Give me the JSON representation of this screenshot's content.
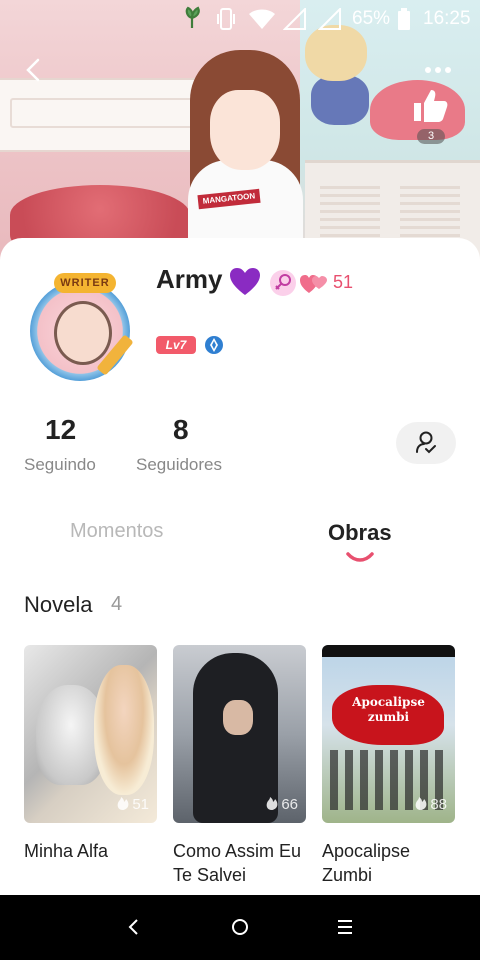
{
  "status_bar": {
    "battery": "65%",
    "time": "16:25"
  },
  "header": {
    "like_count": "3"
  },
  "profile": {
    "username": "Army",
    "avatar_badge": "WRITER",
    "hearts_count": "51",
    "level": "Lv7"
  },
  "stats": [
    {
      "value": "12",
      "label": "Seguindo"
    },
    {
      "value": "8",
      "label": "Seguidores"
    }
  ],
  "tabs": [
    {
      "label": "Momentos",
      "active": false
    },
    {
      "label": "Obras",
      "active": true
    }
  ],
  "section": {
    "title": "Novela",
    "count": "4"
  },
  "books": [
    {
      "title": "Minha Alfa",
      "views": "51"
    },
    {
      "title": "Como Assim Eu Te Salvei",
      "views": "66"
    },
    {
      "title": "Apocalipse Zumbi",
      "views": "88",
      "cover_text": "Apocalipse zumbi"
    }
  ],
  "banner_shirt_text": "MANGATOON",
  "colors": {
    "accent_pink": "#e8506f",
    "level_badge": "#f25a6a",
    "tab_indicator": "#e8506f"
  },
  "icons": {
    "back": "chevron-left-icon",
    "more": "more-dots-icon",
    "like": "thumbs-up-icon",
    "heart": "purple-heart-icon",
    "gender": "female-symbol-icon",
    "hearts": "double-heart-icon",
    "vip": "vip-badge-icon",
    "follow": "person-check-icon",
    "fire": "fire-icon",
    "nav_back": "nav-back-icon",
    "nav_home": "nav-home-icon",
    "nav_menu": "nav-menu-icon"
  }
}
